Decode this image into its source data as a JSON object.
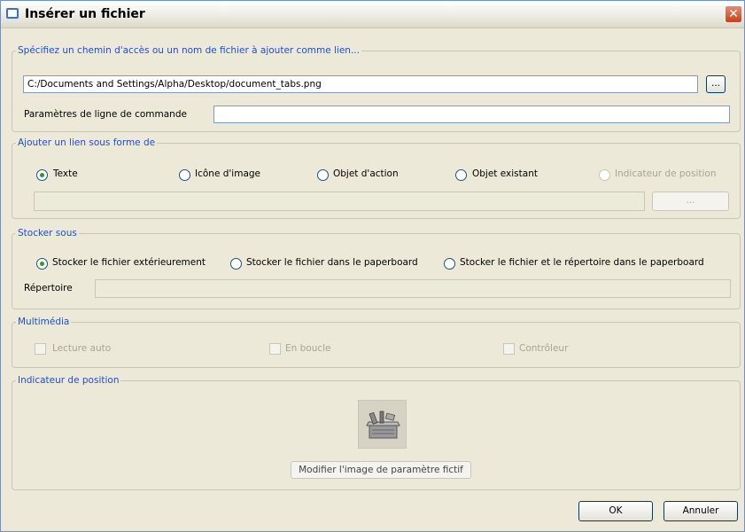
{
  "window": {
    "title": "Insérer un fichier",
    "close_glyph": "✕"
  },
  "path_group": {
    "legend": "Spécifiez un chemin d'accès ou un nom de fichier à ajouter comme lien...",
    "path_value": "C:/Documents and Settings/Alpha/Desktop/document_tabs.png",
    "browse_label": "...",
    "cmdline_label": "Paramètres de ligne de commande",
    "cmdline_value": ""
  },
  "link_group": {
    "legend": "Ajouter un lien sous forme de",
    "options": [
      {
        "label": "Texte",
        "checked": true,
        "enabled": true
      },
      {
        "label": "Icône d'image",
        "checked": false,
        "enabled": true
      },
      {
        "label": "Objet d'action",
        "checked": false,
        "enabled": true
      },
      {
        "label": "Objet existant",
        "checked": false,
        "enabled": true
      },
      {
        "label": "Indicateur de position",
        "checked": false,
        "enabled": false
      }
    ],
    "text_value": "",
    "browse_label": "..."
  },
  "store_group": {
    "legend": "Stocker sous",
    "options": [
      {
        "label": "Stocker le fichier extérieurement",
        "checked": true
      },
      {
        "label": "Stocker le fichier dans le paperboard",
        "checked": false
      },
      {
        "label": "Stocker le fichier et le répertoire dans le paperboard",
        "checked": false
      }
    ],
    "directory_label": "Répertoire",
    "directory_value": ""
  },
  "multimedia_group": {
    "legend": "Multimédia",
    "options": [
      {
        "label": "Lecture auto",
        "checked": false
      },
      {
        "label": "En boucle",
        "checked": false
      },
      {
        "label": "Contrôleur",
        "checked": false
      }
    ]
  },
  "placeholder_group": {
    "legend": "Indicateur de position",
    "image_icon": "toolbox-icon",
    "modify_label": "Modifier l'image de paramètre fictif"
  },
  "footer": {
    "ok_label": "OK",
    "cancel_label": "Annuler"
  }
}
